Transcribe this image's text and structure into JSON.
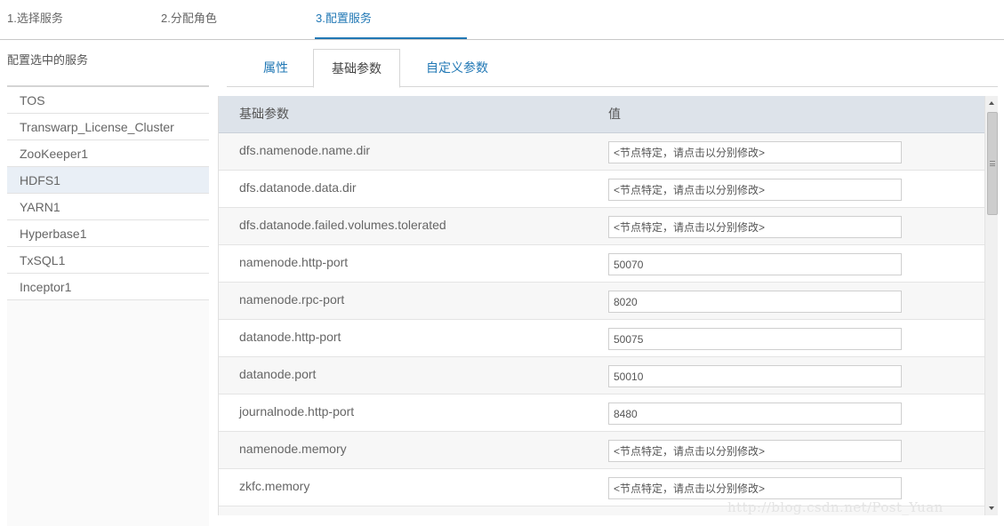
{
  "steps": [
    {
      "label": "1.选择服务"
    },
    {
      "label": "2.分配角色"
    },
    {
      "label": "3.配置服务"
    }
  ],
  "left_panel": {
    "title": "配置选中的服务",
    "services": [
      "TOS",
      "Transwarp_License_Cluster",
      "ZooKeeper1",
      "HDFS1",
      "YARN1",
      "Hyperbase1",
      "TxSQL1",
      "Inceptor1"
    ],
    "selected": "HDFS1"
  },
  "tabs": [
    {
      "label": "属性"
    },
    {
      "label": "基础参数"
    },
    {
      "label": "自定义参数"
    }
  ],
  "active_tab": "基础参数",
  "table": {
    "headers": {
      "param": "基础参数",
      "value": "值"
    },
    "rows": [
      {
        "name": "dfs.namenode.name.dir",
        "value": "",
        "placeholder": "<节点特定，请点击以分别修改>"
      },
      {
        "name": "dfs.datanode.data.dir",
        "value": "",
        "placeholder": "<节点特定，请点击以分别修改>"
      },
      {
        "name": "dfs.datanode.failed.volumes.tolerated",
        "value": "",
        "placeholder": "<节点特定，请点击以分别修改>"
      },
      {
        "name": "namenode.http-port",
        "value": "50070",
        "placeholder": ""
      },
      {
        "name": "namenode.rpc-port",
        "value": "8020",
        "placeholder": ""
      },
      {
        "name": "datanode.http-port",
        "value": "50075",
        "placeholder": ""
      },
      {
        "name": "datanode.port",
        "value": "50010",
        "placeholder": ""
      },
      {
        "name": "journalnode.http-port",
        "value": "8480",
        "placeholder": ""
      },
      {
        "name": "namenode.memory",
        "value": "",
        "placeholder": "<节点特定，请点击以分别修改>"
      },
      {
        "name": "zkfc.memory",
        "value": "",
        "placeholder": "<节点特定，请点击以分别修改>"
      },
      {
        "name": "",
        "value": "",
        "placeholder": ""
      }
    ]
  },
  "watermark": "http://blog.csdn.net/Post_Yuan",
  "colors": {
    "accent": "#2178b5",
    "header_bg": "#dde3ea",
    "selected_row": "#e9eff6"
  }
}
